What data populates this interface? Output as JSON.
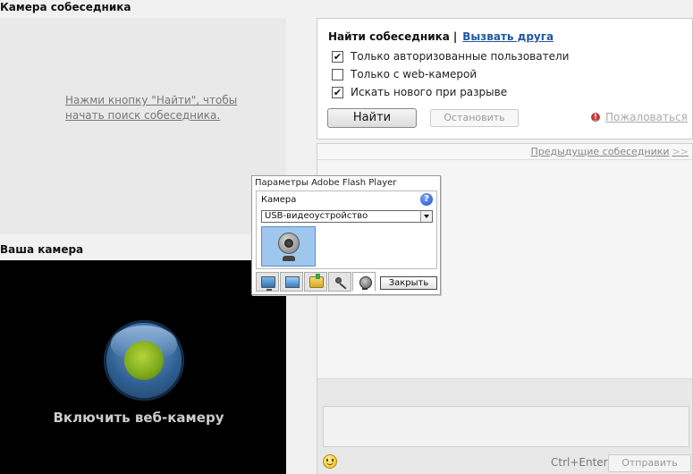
{
  "partner": {
    "title": "Камера собеседника",
    "hint_line1": "Нажми кнопку \"Найти\", чтобы",
    "hint_line2": "начать поиск собеседника."
  },
  "own_camera": {
    "title": "Ваша камера",
    "enable_label": "Включить веб-камеру"
  },
  "search_panel": {
    "find_partner_label": "Найти собеседника",
    "separator": "|",
    "invite_friend_label": "Вызвать друга",
    "options": [
      {
        "label": "Только авторизованные пользователи",
        "checked": true
      },
      {
        "label": "Только с web-камерой",
        "checked": false
      },
      {
        "label": "Искать нового при разрыве",
        "checked": true
      }
    ],
    "find_button": "Найти",
    "stop_button": "Остановить",
    "report_label": "Пожаловаться"
  },
  "chat": {
    "previous_partners_label": "Предыдущие собеседники",
    "previous_arrow": ">>",
    "hotkey_label": "Ctrl+Enter",
    "send_button": "Отправить"
  },
  "flash_dialog": {
    "title": "Параметры Adobe Flash Player",
    "section_label": "Камера",
    "help_glyph": "?",
    "selected_device": "USB-видеоустройство",
    "close_button": "Закрыть",
    "tabs": [
      "privacy-icon",
      "display-icon",
      "storage-icon",
      "microphone-icon",
      "camera-icon"
    ],
    "active_tab": "camera-icon"
  },
  "colors": {
    "link": "#2257a0",
    "camera_button": "#2f5f91",
    "camera_dot": "#7ba81a",
    "report_icon": "#c53b3b"
  }
}
